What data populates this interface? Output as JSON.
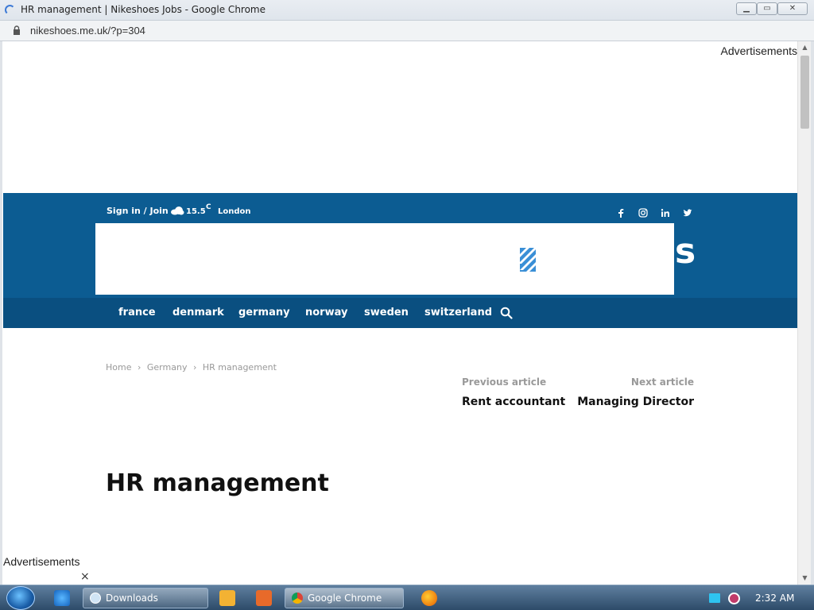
{
  "window": {
    "title": "HR management | Nikeshoes Jobs - Google Chrome",
    "url": "nikeshoes.me.uk/?p=304"
  },
  "ads": {
    "top_label": "Advertisements",
    "bottom_label": "Advertisements",
    "close": "×"
  },
  "topbar": {
    "sign_in": "Sign in / Join",
    "temperature": "15.5",
    "unit": "C",
    "city": "London",
    "social_icons": [
      "facebook-icon",
      "instagram-icon",
      "linkedin-icon",
      "twitter-icon"
    ]
  },
  "logo": {
    "tail_text": "s"
  },
  "nav": {
    "items": [
      "france",
      "denmark",
      "germany",
      "norway",
      "sweden",
      "switzerland"
    ]
  },
  "breadcrumb": {
    "items": [
      "Home",
      "Germany",
      "HR management"
    ],
    "separator": "›"
  },
  "article_nav": {
    "prev_label": "Previous article",
    "prev_title": "Rent accountant",
    "next_label": "Next article",
    "next_title": "Managing Director"
  },
  "article": {
    "title": "HR management"
  },
  "taskbar": {
    "downloads_label": "Downloads",
    "chrome_label": "Google Chrome",
    "clock": "2:32 AM"
  },
  "colors": {
    "header_blue": "#0c5c92",
    "nav_blue": "#0a4f80"
  }
}
